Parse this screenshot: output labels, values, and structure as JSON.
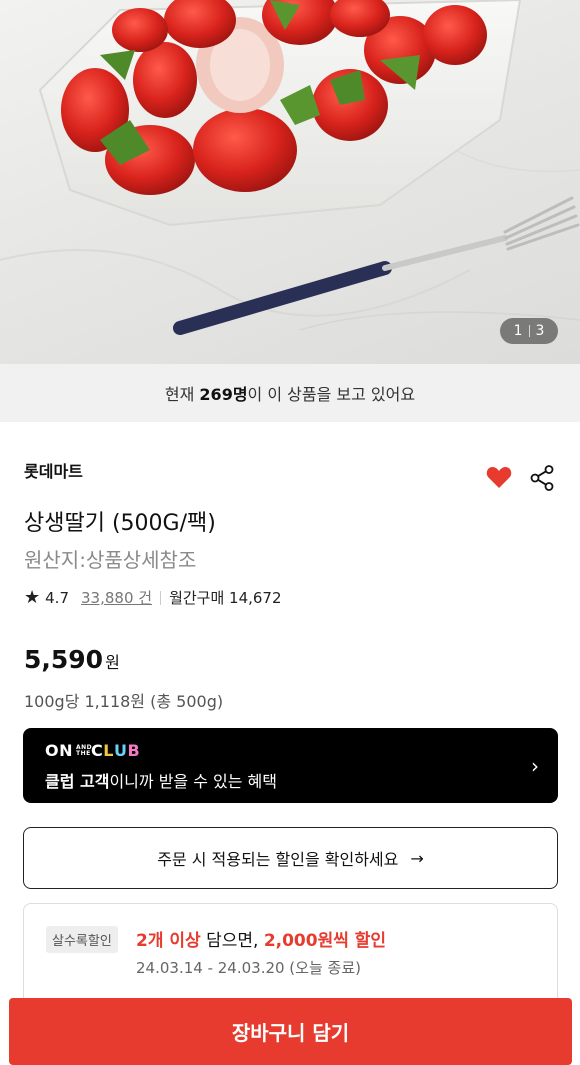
{
  "gallery": {
    "current": "1",
    "total": "3",
    "image_icon": "strawberry-product-photo"
  },
  "viewers": {
    "prefix": "현재 ",
    "count": "269명",
    "suffix": "이 이 상품을 보고 있어요"
  },
  "product": {
    "brand": "롯데마트",
    "title": "상생딸기 (500G/팩)",
    "origin": "원산지:상품상세참조",
    "rating": "4.7",
    "review_count": "33,880 건",
    "monthly_label": "월간구매 14,672",
    "price": "5,590",
    "price_unit": "원",
    "unit_price": "100g당 1,118원 (총 500g)",
    "wishlist_icon": "heart-icon",
    "share_icon": "share-icon",
    "accent_color": "#e63b2e"
  },
  "club": {
    "logo_on": "ON",
    "logo_and": "AND",
    "logo_the": "THE",
    "logo_c": "C",
    "logo_l": "L",
    "logo_u": "U",
    "logo_b": "B",
    "text_bold": "클럽 고객",
    "text_rest": "이니까 받을 수 있는 혜택",
    "arrow": "›"
  },
  "discount_check": {
    "label": "주문 시 적용되는 할인을 확인하세요",
    "arrow": "→"
  },
  "promo": {
    "tag": "살수록할인",
    "qty": "2개 이상",
    "mid": " 담으면, ",
    "amount": "2,000원씩 할인",
    "date": "24.03.14 - 24.03.20 (오늘 종료)"
  },
  "cta": {
    "label": "장바구니 담기"
  }
}
